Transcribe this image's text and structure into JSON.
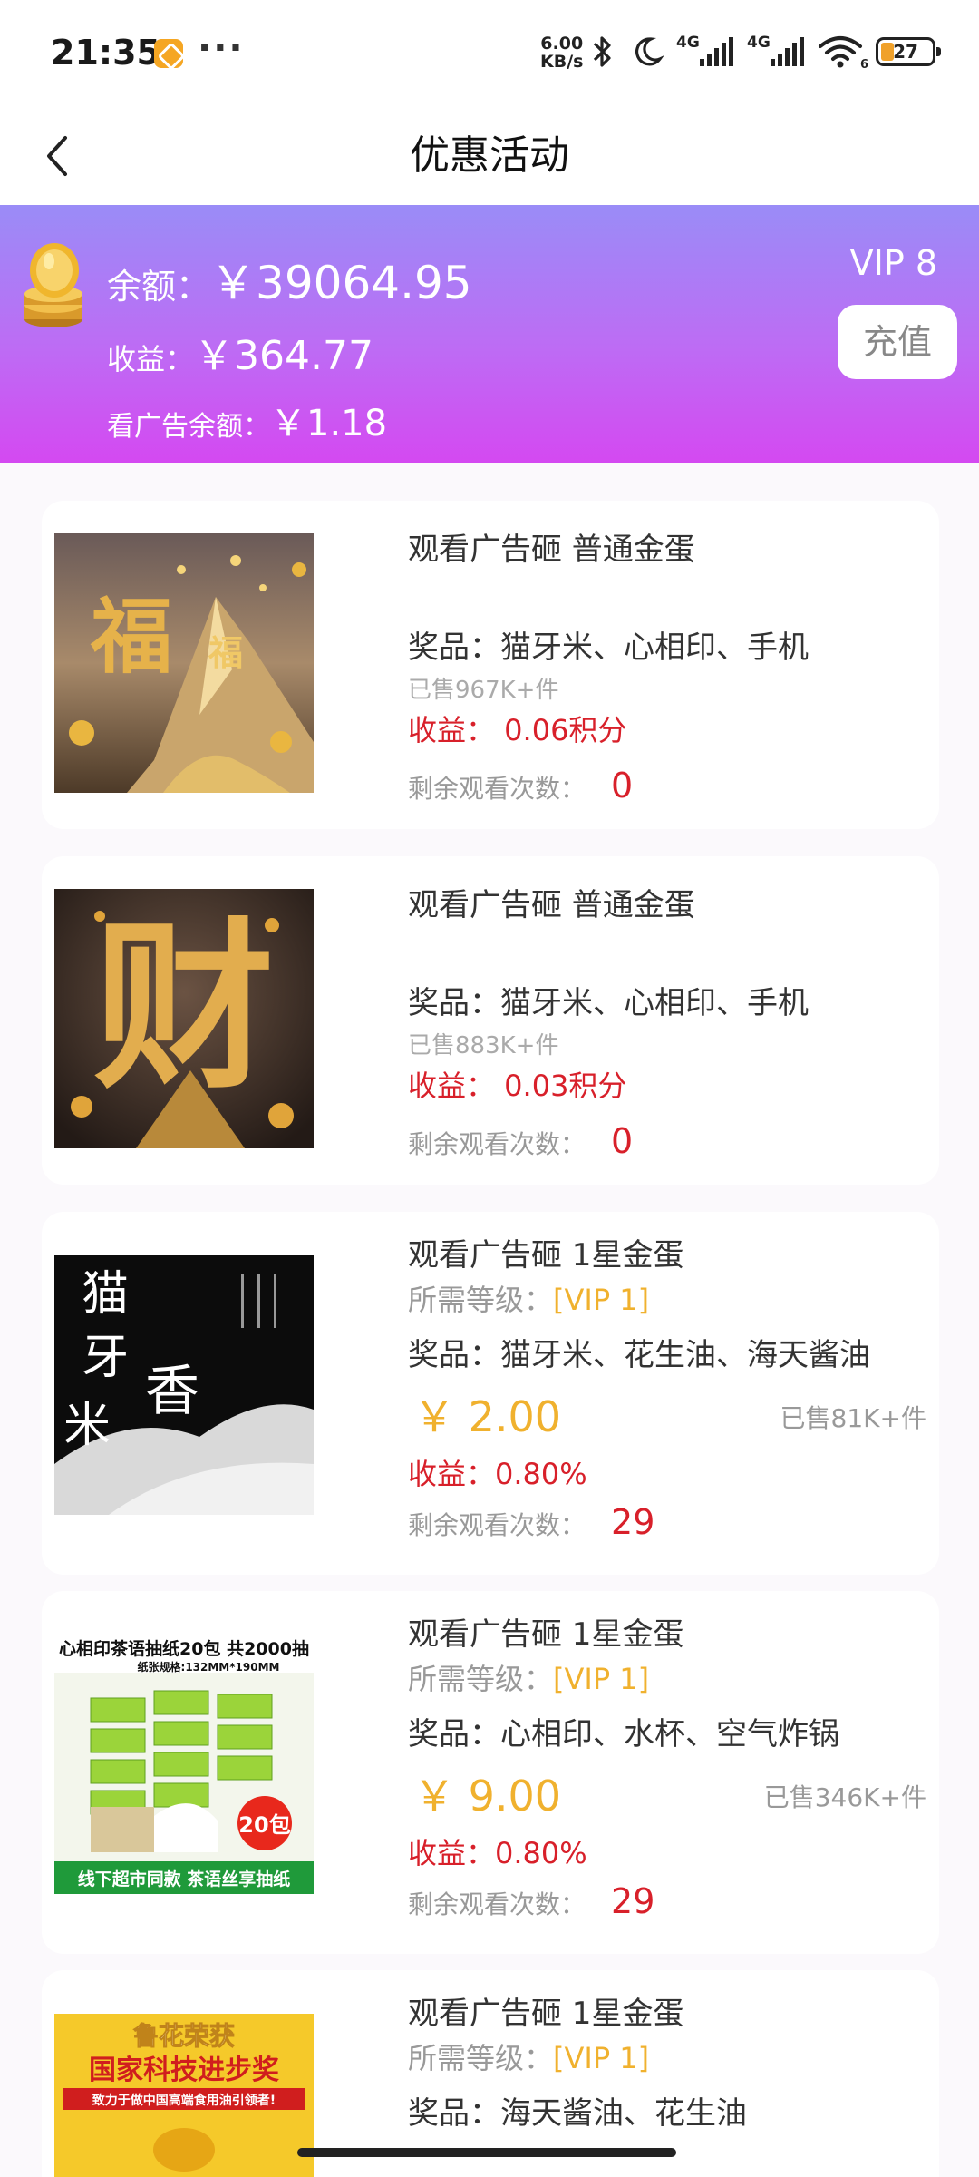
{
  "status_bar": {
    "time": "21:35",
    "speed_value": "6.00",
    "speed_unit": "KB/s",
    "network_1": "4G",
    "network_2": "4G",
    "wifi_level": "6",
    "battery": "27"
  },
  "header": {
    "title": "优惠活动"
  },
  "balance": {
    "balance_label": "余额：",
    "balance_value": "￥39064.95",
    "income_label": "收益：",
    "income_value": "￥364.77",
    "ad_balance_label": "看广告余额：",
    "ad_balance_value": "￥1.18",
    "vip_level": "VIP 8",
    "recharge_label": "充值"
  },
  "products": [
    {
      "title": "观看广告砸 普通金蛋",
      "prize": "奖品：猫牙米、心相印、手机",
      "sold": "已售967K+件",
      "income": "收益：  0.06积分",
      "remain_label": "剩余观看次数：",
      "remain_count": "0",
      "image_text": "福"
    },
    {
      "title": "观看广告砸 普通金蛋",
      "prize": "奖品：猫牙米、心相印、手机",
      "sold": "已售883K+件",
      "income": "收益：  0.03积分",
      "remain_label": "剩余观看次数：",
      "remain_count": "0",
      "image_text": "财"
    },
    {
      "title": "观看广告砸 1星金蛋",
      "level_label": "所需等级：",
      "level_value": "[VIP 1]",
      "prize": "奖品：猫牙米、花生油、海天酱油",
      "price": "￥ 2.00",
      "sold": "已售81K+件",
      "income": "收益：0.80%",
      "remain_label": "剩余观看次数：",
      "remain_count": "29",
      "image_text_1": "猫",
      "image_text_2": "牙",
      "image_text_3": "香",
      "image_text_4": "米"
    },
    {
      "title": "观看广告砸 1星金蛋",
      "level_label": "所需等级：",
      "level_value": "[VIP 1]",
      "prize": "奖品：心相印、水杯、空气炸锅",
      "price": "￥ 9.00",
      "sold": "已售346K+件",
      "income": "收益：0.80%",
      "remain_label": "剩余观看次数：",
      "remain_count": "29",
      "image_header": "心相印茶语抽纸20包 共2000抽",
      "image_spec": "纸张规格:132MM*190MM",
      "image_badge": "20包",
      "image_footer": "线下超市同款 茶语丝享抽纸"
    },
    {
      "title": "观看广告砸 1星金蛋",
      "level_label": "所需等级：",
      "level_value": "[VIP 1]",
      "prize": "奖品：海天酱油、花生油",
      "image_line_1": "鲁花荣获",
      "image_line_2": "国家科技进步奖",
      "image_line_3": "致力于做中国高端食用油引领者!"
    }
  ],
  "colors": {
    "banner_top": "#9a8cf7",
    "banner_bottom": "#d449f1",
    "income_red": "#d8202a",
    "price_gold": "#f0b12e"
  }
}
